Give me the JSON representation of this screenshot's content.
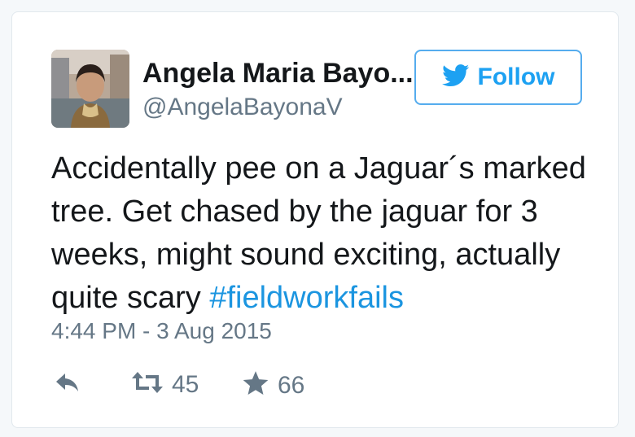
{
  "tweet": {
    "author_name": "Angela Maria Bayo...",
    "author_handle": "@AngelaBayonaV",
    "follow_label": "Follow",
    "text_lines": [
      "Accidentally pee on a Jaguar´s marked",
      "tree. Get chased by the jaguar for 3",
      "weeks, might sound exciting, actually",
      "quite scary "
    ],
    "hashtag": "#fieldworkfails",
    "timestamp": "4:44 PM - 3 Aug 2015",
    "retweet_count": "45",
    "like_count": "66"
  },
  "icons": {
    "reply": "reply-icon",
    "retweet": "retweet-icon",
    "like": "star-icon",
    "follow": "twitter-bird-icon"
  },
  "colors": {
    "accent": "#1da1f2",
    "hashtag": "#1b95e0",
    "muted": "#657786",
    "text": "#14171a"
  }
}
